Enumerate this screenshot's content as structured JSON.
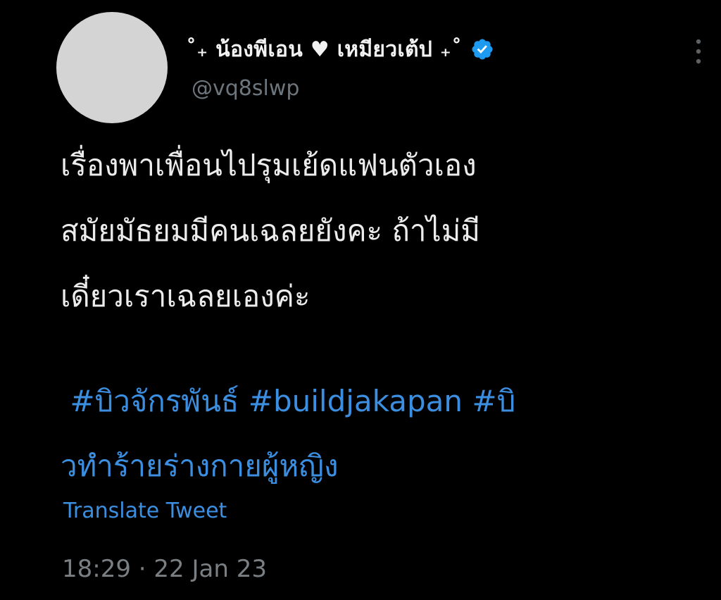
{
  "tweet": {
    "author": {
      "display_name": "˚₊ น้องพีเอน ♥ เหมียวเต้ป ₊˚",
      "handle": "@vq8slwp",
      "verified": true
    },
    "body_lines": [
      "เรื่องพาเพื่อนไปรุมเย้ดแฟนตัวเอง",
      "สมัยมัธยมมีคนเฉลยยังคะ ถ้าไม่มี",
      "เดี๋ยวเราเฉลยเองค่ะ"
    ],
    "hashtags": {
      "line1": [
        "#บิวจักรพันธ์",
        "#buildjakapan",
        "#บิ"
      ],
      "line2": "วทำร้ายร่างกายผู้หญิง"
    },
    "translate_label": "Translate Tweet",
    "time": "18:29",
    "separator": "·",
    "date": "22 Jan 23"
  },
  "icons": {
    "verified": "verified-badge-icon",
    "more": "more-options-icon"
  },
  "colors": {
    "background": "#000000",
    "link": "#3b8ee0",
    "verified_badge": "#1d9bf0",
    "muted": "#6e767d"
  }
}
